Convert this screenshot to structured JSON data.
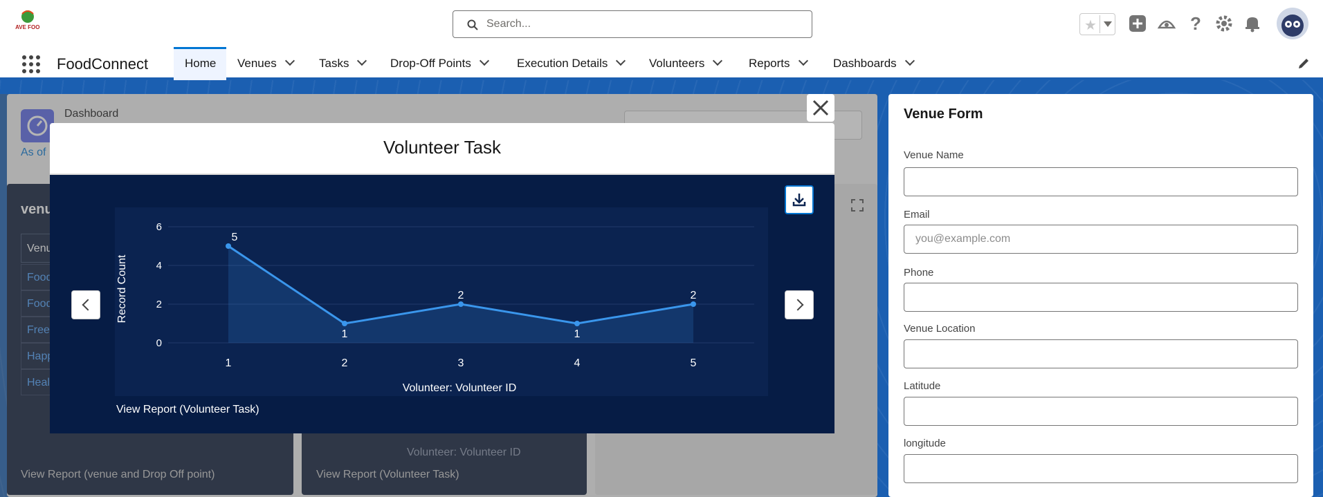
{
  "header": {
    "logo_text": "SAVE FOOD",
    "search_placeholder": "Search..."
  },
  "nav": {
    "app_name": "FoodConnect",
    "tabs": [
      {
        "label": "Home"
      },
      {
        "label": "Venues"
      },
      {
        "label": "Tasks"
      },
      {
        "label": "Drop-Off Points"
      },
      {
        "label": "Execution Details"
      },
      {
        "label": "Volunteers"
      },
      {
        "label": "Reports"
      },
      {
        "label": "Dashboards"
      }
    ]
  },
  "dashboard": {
    "title": "Dashboard",
    "as_of": "As of",
    "widget1": {
      "title": "venu",
      "column": "Venu",
      "rows": [
        "Food",
        "Food",
        "Free",
        "Happ",
        "Heal"
      ],
      "footer": "View Report (venue and Drop Off point)"
    },
    "widget2": {
      "axis": "Volunteer: Volunteer ID",
      "footer": "View Report (Volunteer Task)"
    }
  },
  "modal": {
    "title": "Volunteer Task",
    "view_report": "View Report (Volunteer Task)"
  },
  "chart_data": {
    "type": "area",
    "title": "",
    "xlabel": "Volunteer: Volunteer ID",
    "ylabel": "Record Count",
    "x": [
      "1",
      "2",
      "3",
      "4",
      "5"
    ],
    "values": [
      5,
      1,
      2,
      1,
      2
    ],
    "y_ticks": [
      "0",
      "2",
      "4",
      "6"
    ],
    "ylim": [
      0,
      6
    ],
    "color": "#3a96ec"
  },
  "form": {
    "title": "Venue Form",
    "fields": [
      {
        "label": "Venue Name",
        "placeholder": ""
      },
      {
        "label": "Email",
        "placeholder": "you@example.com"
      },
      {
        "label": "Phone",
        "placeholder": ""
      },
      {
        "label": "Venue Location",
        "placeholder": ""
      },
      {
        "label": "Latitude",
        "placeholder": ""
      },
      {
        "label": "longitude",
        "placeholder": ""
      }
    ]
  }
}
